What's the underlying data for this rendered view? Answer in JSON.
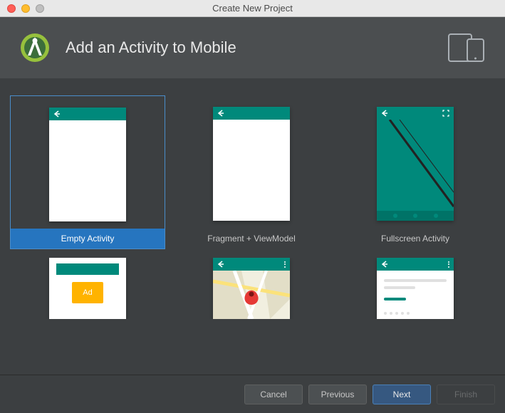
{
  "window": {
    "title": "Create New Project"
  },
  "header": {
    "title": "Add an Activity to Mobile"
  },
  "templates": [
    {
      "label": "Empty Activity"
    },
    {
      "label": "Fragment + ViewModel"
    },
    {
      "label": "Fullscreen Activity"
    }
  ],
  "ad_text": "Ad",
  "buttons": {
    "cancel": "Cancel",
    "previous": "Previous",
    "next": "Next",
    "finish": "Finish"
  }
}
